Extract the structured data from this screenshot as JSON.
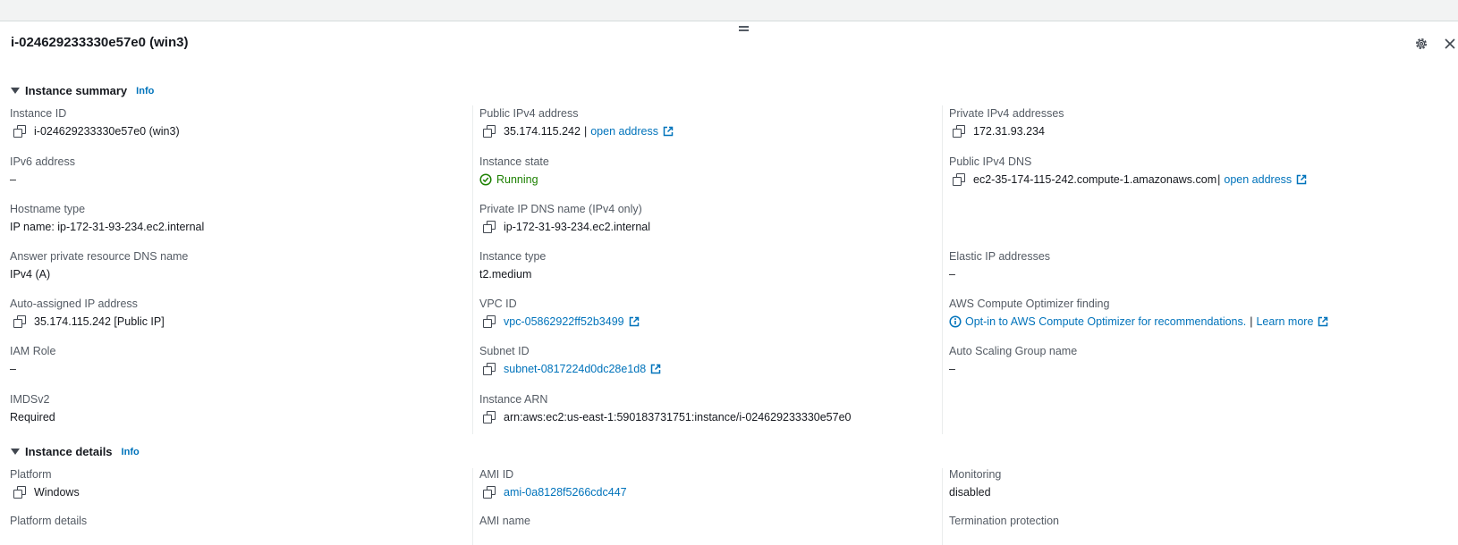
{
  "instance_title": "i-024629233330e57e0 (win3)",
  "summary": {
    "title": "Instance summary",
    "info": "Info",
    "instance_id": {
      "label": "Instance ID",
      "value": "i-024629233330e57e0 (win3)"
    },
    "ipv6": {
      "label": "IPv6 address",
      "value": "–"
    },
    "hostname_type": {
      "label": "Hostname type",
      "value": "IP name: ip-172-31-93-234.ec2.internal"
    },
    "answer_dns": {
      "label": "Answer private resource DNS name",
      "value": "IPv4 (A)"
    },
    "auto_ip": {
      "label": "Auto-assigned IP address",
      "value": "35.174.115.242 [Public IP]"
    },
    "iam_role": {
      "label": "IAM Role",
      "value": "–"
    },
    "imdsv2": {
      "label": "IMDSv2",
      "value": "Required"
    },
    "public_ipv4": {
      "label": "Public IPv4 address",
      "value": "35.174.115.242",
      "sep": "|",
      "link": "open address"
    },
    "instance_state": {
      "label": "Instance state",
      "value": "Running"
    },
    "private_dns": {
      "label": "Private IP DNS name (IPv4 only)",
      "value": "ip-172-31-93-234.ec2.internal"
    },
    "instance_type": {
      "label": "Instance type",
      "value": "t2.medium"
    },
    "vpc_id": {
      "label": "VPC ID",
      "value": "vpc-05862922ff52b3499"
    },
    "subnet_id": {
      "label": "Subnet ID",
      "value": "subnet-0817224d0dc28e1d8"
    },
    "instance_arn": {
      "label": "Instance ARN",
      "value": "arn:aws:ec2:us-east-1:590183731751:instance/i-024629233330e57e0"
    },
    "private_ipv4": {
      "label": "Private IPv4 addresses",
      "value": "172.31.93.234"
    },
    "public_dns": {
      "label": "Public IPv4 DNS",
      "value": "ec2-35-174-115-242.compute-1.amazonaws.com",
      "sep": "|",
      "link": "open address"
    },
    "elastic_ip": {
      "label": "Elastic IP addresses",
      "value": "–"
    },
    "optimizer": {
      "label": "AWS Compute Optimizer finding",
      "link": "Opt-in to AWS Compute Optimizer for recommendations.",
      "sep": "|",
      "learn_more": "Learn more"
    },
    "asg_name": {
      "label": "Auto Scaling Group name",
      "value": "–"
    }
  },
  "details": {
    "title": "Instance details",
    "info": "Info",
    "platform": {
      "label": "Platform",
      "value": "Windows"
    },
    "ami_id": {
      "label": "AMI ID",
      "value": "ami-0a8128f5266cdc447"
    },
    "monitoring": {
      "label": "Monitoring",
      "value": "disabled"
    },
    "platform_details": {
      "label": "Platform details"
    },
    "ami_name": {
      "label": "AMI name"
    },
    "termination": {
      "label": "Termination protection"
    }
  },
  "colors": {
    "link": "#0073bb",
    "running": "#1d8102",
    "label": "#545b64"
  }
}
